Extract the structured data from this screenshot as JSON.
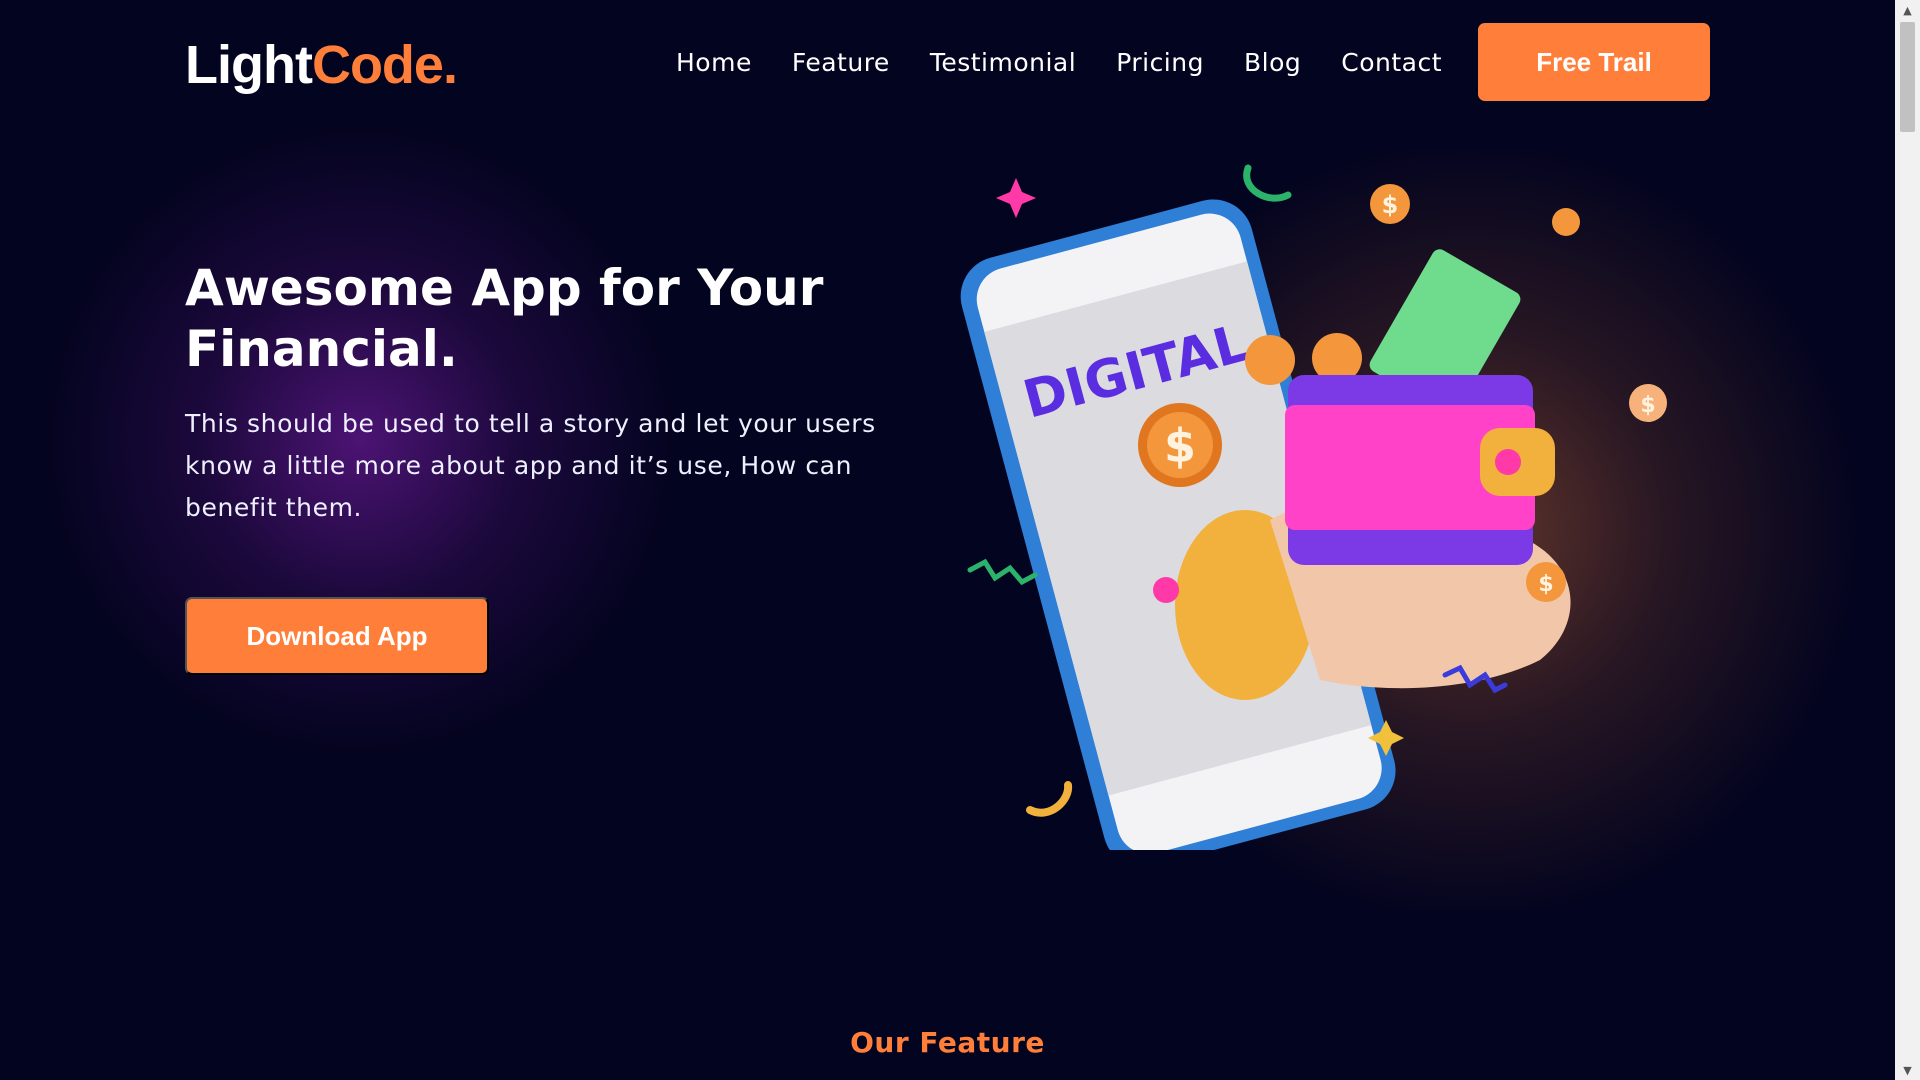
{
  "logo": {
    "part1": "Light",
    "part2": "Code."
  },
  "nav": {
    "items": [
      "Home",
      "Feature",
      "Testimonial",
      "Pricing",
      "Blog",
      "Contact"
    ],
    "cta": "Free Trail"
  },
  "hero": {
    "title": "Awesome App for Your Financial.",
    "description": "This should be used to tell a story and let your users know a little more about app and it’s use, How can benefit them.",
    "cta": "Download App",
    "illustration_text": "DIGITAL"
  },
  "features": {
    "title": "Our Feature"
  },
  "colors": {
    "background": "#03041f",
    "accent": "#ff7f3a",
    "text": "#ffffff"
  },
  "icons": [
    "chevron-up-icon",
    "chevron-down-icon",
    "dollar-coin-icon",
    "sparkle-icon"
  ]
}
